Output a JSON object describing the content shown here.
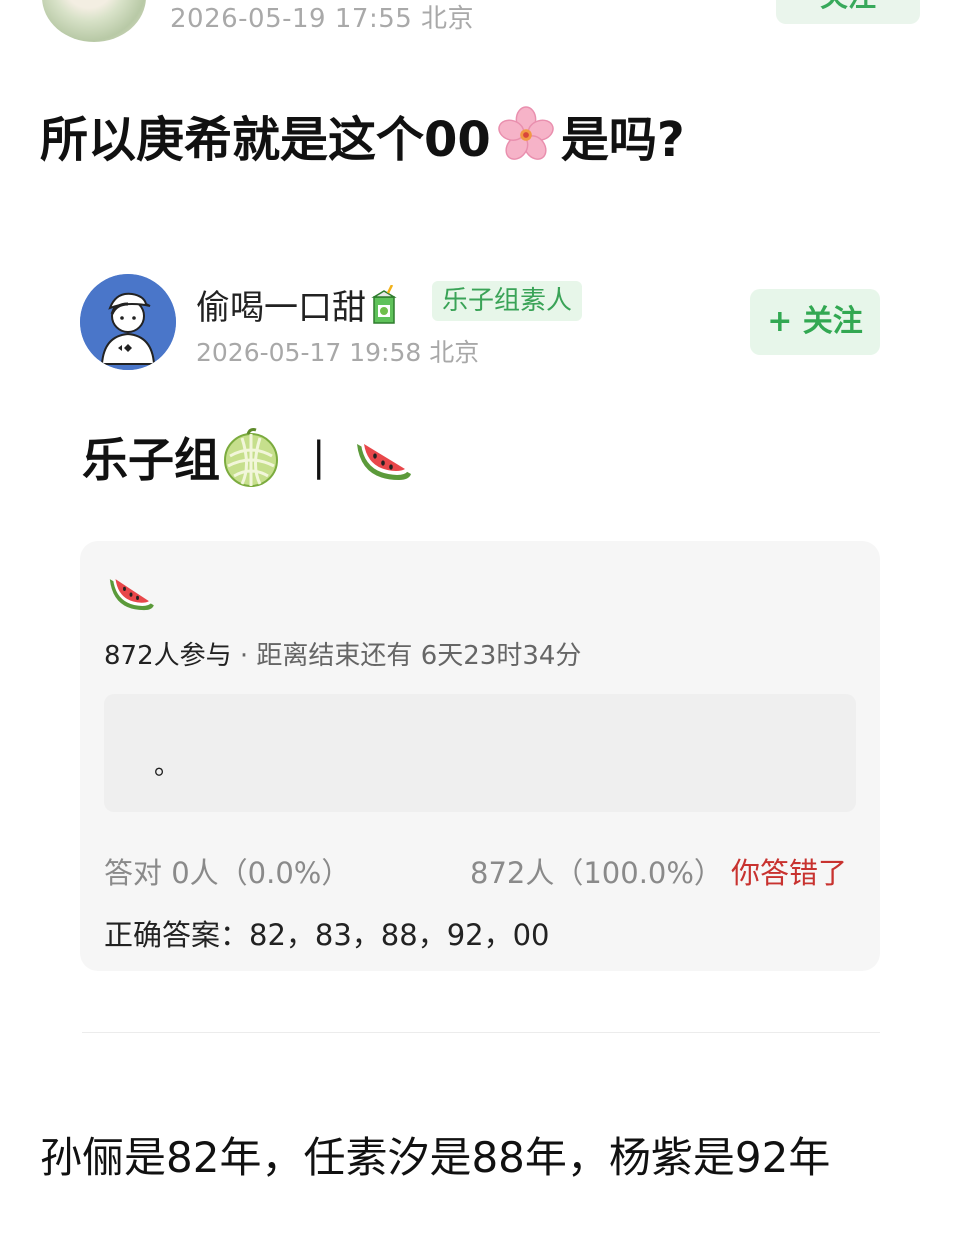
{
  "top_post": {
    "timestamp": "2026-05-19 17:55 北京",
    "follow_label": "关注",
    "text_before_emoji": "所以庚希就是这个00",
    "emoji": "cherry-blossom",
    "text_after_emoji": "是吗?"
  },
  "embedded_post": {
    "username": "偷喝一口甜",
    "username_emoji": "juice-box",
    "badge": "乐子组素人",
    "timestamp": "2026-05-17 19:58 北京",
    "follow_label": "+ 关注",
    "title": "乐子组",
    "title_emojis": [
      "melon",
      "watermelon"
    ],
    "separator": "|"
  },
  "quiz": {
    "emoji": "watermelon",
    "participants": "872人参与",
    "deadline": "· 距离结束还有 6天23时34分",
    "answer_text": "。",
    "correct_stat": "答对  0人（0.0%）",
    "wrong_stat": "872人（100.0%）",
    "result_label": "你答错了",
    "correct_answer": "正确答案：82，83，88，92，00"
  },
  "comment": {
    "text": "孙俪是82年，任素汐是88年，杨紫是92年"
  },
  "colors": {
    "accent_green": "#38a95b",
    "error_red": "#c8322f",
    "avatar_blue": "#4a76c9"
  }
}
